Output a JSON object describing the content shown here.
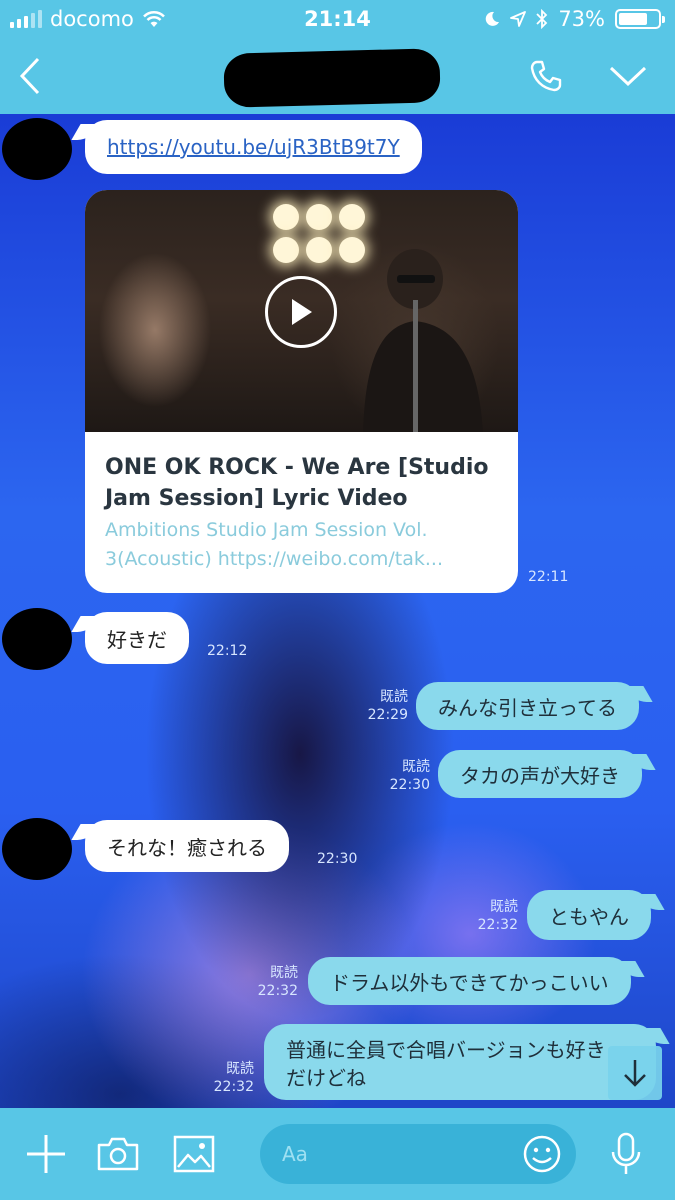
{
  "status_bar": {
    "carrier": "docomo",
    "time": "21:14",
    "battery": "73%",
    "battery_level": 0.73
  },
  "header": {
    "back_icon": "chevron-left-icon",
    "call_icon": "phone-icon",
    "menu_icon": "chevron-down-icon"
  },
  "chat": {
    "link_message": {
      "url": "https://youtu.be/ujR3BtB9t7Y"
    },
    "link_card": {
      "title_line1": "ONE OK ROCK - We Are [Studio",
      "title_line2": "Jam Session] Lyric Video",
      "desc_line1": "Ambitions Studio Jam Session Vol.",
      "desc_line2": "3(Acoustic) https://weibo.com/tak...",
      "time": "22:11"
    },
    "messages": [
      {
        "side": "in",
        "text": "好きだ",
        "time": "22:12"
      },
      {
        "side": "out",
        "text": "みんな引き立ってる",
        "read": "既読",
        "time": "22:29"
      },
      {
        "side": "out",
        "text": "タカの声が大好き",
        "read": "既読",
        "time": "22:30"
      },
      {
        "side": "in",
        "text": "それな！癒される",
        "time": "22:30"
      },
      {
        "side": "out",
        "text": "ともやん",
        "read": "既読",
        "time": "22:32"
      },
      {
        "side": "out",
        "text": "ドラム以外もできてかっこいい",
        "read": "既読",
        "time": "22:32"
      },
      {
        "side": "out",
        "text_line1": "普通に全員で合唱バージョンも好き",
        "text_line2": "だけどね",
        "read": "既読",
        "time": "22:32"
      }
    ]
  },
  "input_bar": {
    "placeholder": "Aa",
    "icons": [
      "plus-icon",
      "camera-icon",
      "image-icon",
      "emoji-icon",
      "microphone-icon"
    ]
  },
  "colors": {
    "bar": "#58c6e6",
    "my_bubble": "#8ad9ec",
    "their_bubble": "#ffffff",
    "link": "#2a63c4"
  }
}
